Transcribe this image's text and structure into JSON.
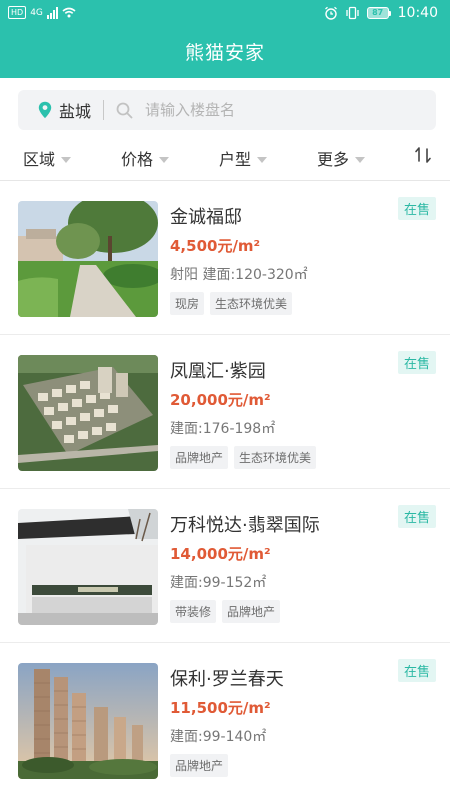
{
  "status_bar": {
    "network": "HD",
    "signal": "4G",
    "battery": "87",
    "time": "10:40"
  },
  "header": {
    "title": "熊猫安家"
  },
  "search": {
    "city": "盐城",
    "placeholder": "请输入楼盘名",
    "icons": [
      "location-pin-icon",
      "search-icon"
    ]
  },
  "filters": {
    "items": [
      {
        "label": "区域"
      },
      {
        "label": "价格"
      },
      {
        "label": "户型"
      },
      {
        "label": "更多"
      }
    ],
    "sort_icon": "sort-arrows-icon"
  },
  "listings": [
    {
      "name": "金诚福邸",
      "price": "4,500元/m²",
      "meta": "射阳 建面:120-320㎡",
      "tags": [
        "现房",
        "生态环境优美"
      ],
      "status": "在售",
      "image": "garden-path-photo"
    },
    {
      "name": "凤凰汇·紫园",
      "price": "20,000元/m²",
      "meta": "建面:176-198㎡",
      "tags": [
        "品牌地产",
        "生态环境优美"
      ],
      "status": "在售",
      "image": "aerial-villas-photo"
    },
    {
      "name": "万科悦达·翡翠国际",
      "price": "14,000元/m²",
      "meta": "建面:99-152㎡",
      "tags": [
        "带装修",
        "品牌地产"
      ],
      "status": "在售",
      "image": "sales-center-photo"
    },
    {
      "name": "保利·罗兰春天",
      "price": "11,500元/m²",
      "meta": "建面:99-140㎡",
      "tags": [
        "品牌地产"
      ],
      "status": "在售",
      "image": "highrise-towers-photo"
    }
  ],
  "colors": {
    "brand": "#2bc1ad",
    "price": "#e05a36",
    "badge_bg": "#e3f6f3",
    "badge_text": "#2bb8a4"
  }
}
